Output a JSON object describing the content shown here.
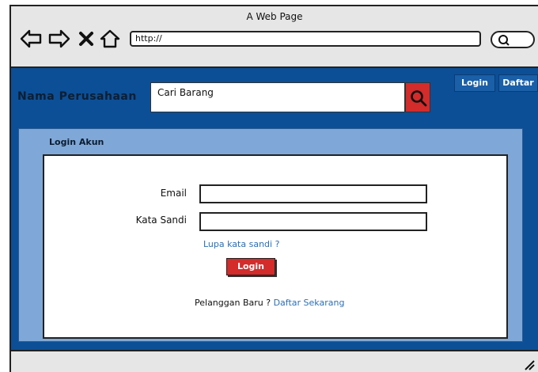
{
  "window": {
    "title": "A Web Page"
  },
  "browser": {
    "url": "http://",
    "icons": [
      "back-arrow-icon",
      "forward-arrow-icon",
      "close-x-icon",
      "home-icon",
      "search-icon"
    ]
  },
  "header": {
    "company": "Nama Perusahaan",
    "search_placeholder": "Cari Barang",
    "login_label": "Login",
    "register_label": "Daftar"
  },
  "login": {
    "title": "Login Akun",
    "email_label": "Email",
    "password_label": "Kata Sandi",
    "forgot_link": "Lupa kata sandi ?",
    "button": "Login",
    "new_customer_text": "Pelanggan Baru ?",
    "register_link": "Daftar Sekarang"
  },
  "colors": {
    "brand_blue": "#0c4f96",
    "panel_blue": "#7fa8d8",
    "accent_red": "#d42b2b",
    "link_blue": "#2c6fb5"
  }
}
